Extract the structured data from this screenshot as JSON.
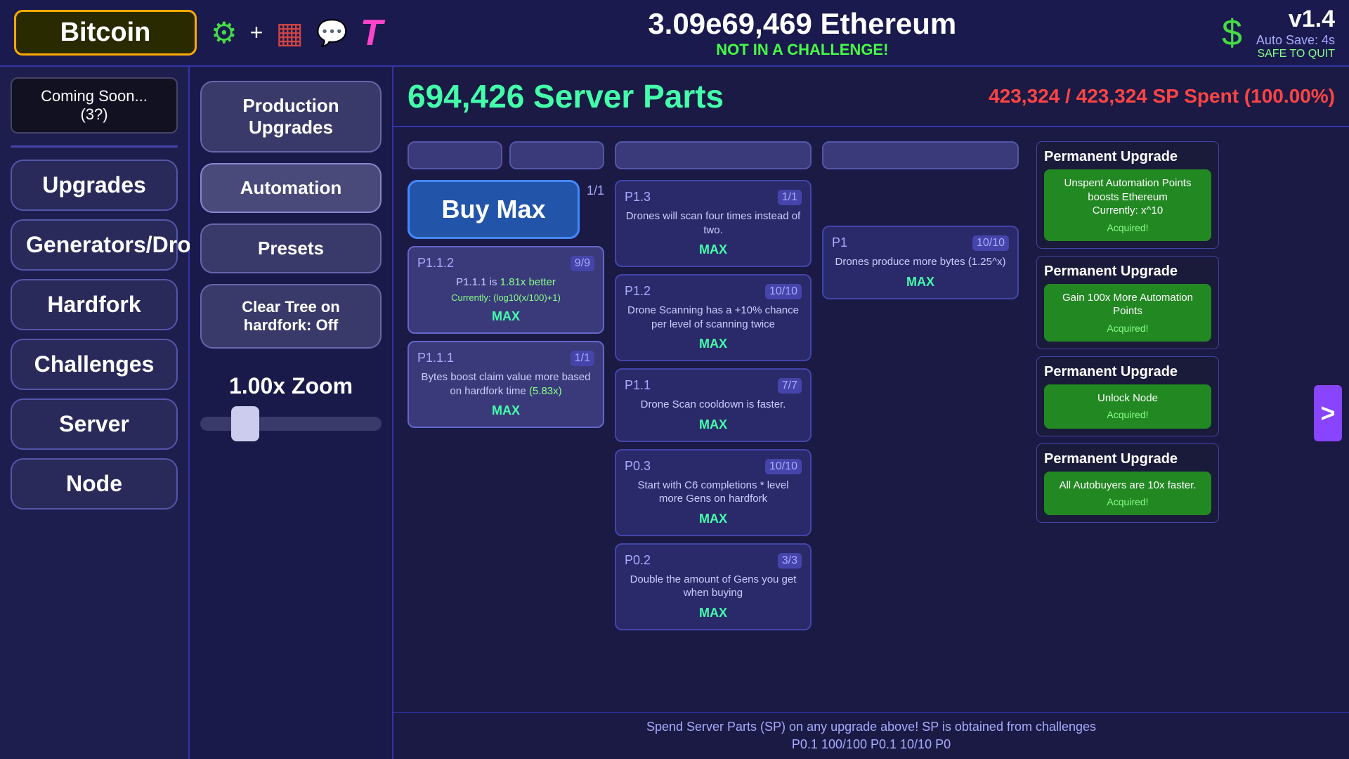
{
  "topbar": {
    "bitcoin_label": "Bitcoin",
    "ethereum_amount": "3.09e69,469 Ethereum",
    "challenge_status": "NOT IN A CHALLENGE!",
    "version": "v1.4",
    "autosave": "Auto Save: 4s",
    "safe_to_quit": "SAFE TO QUIT"
  },
  "sidebar": {
    "coming_soon": "Coming Soon... (3?)",
    "nav_items": [
      "Upgrades",
      "Generators/Drones",
      "Hardfork",
      "Challenges",
      "Server",
      "Node"
    ]
  },
  "panel": {
    "production_upgrades": "Production Upgrades",
    "automation": "Automation",
    "presets": "Presets",
    "clear_tree": "Clear Tree on hardfork: Off",
    "zoom_label": "1.00x Zoom"
  },
  "main": {
    "server_parts_title": "694,426 Server Parts",
    "sp_spent": "423,324 / 423,324 SP Spent (100.00%)",
    "buy_max": "Buy Max",
    "footer": "Spend Server Parts (SP) on any upgrade above! SP is obtained from challenges",
    "footer2": "P0.1   100/100    P0.1   10/10    P0"
  },
  "upgrades": {
    "left_col": [
      {
        "id": "buy_max",
        "label": "Buy Max",
        "badge": "1/1",
        "is_buy_max": true
      },
      {
        "id": "p1_1_2",
        "label": "P1.1.2",
        "badge": "9/9",
        "body": "P1.1.1 is 1.81x better",
        "sub": "Currently: (log10(x/100)+1)",
        "max": "MAX"
      },
      {
        "id": "p1_1_1",
        "label": "P1.1.1",
        "badge": "1/1",
        "body": "Bytes boost claim value more based on hardfork time (5.83x)",
        "max": "MAX"
      }
    ],
    "center_col": [
      {
        "id": "p1_3",
        "label": "P1.3",
        "badge": "1/1",
        "body": "Drones will scan four times instead of two.",
        "max": "MAX"
      },
      {
        "id": "p1_2",
        "label": "P1.2",
        "badge": "10/10",
        "body": "Drone Scanning has a +10% chance per level of scanning twice",
        "max": "MAX"
      },
      {
        "id": "p1_1",
        "label": "P1.1",
        "badge": "7/7",
        "body": "Drone Scan cooldown is faster.",
        "max": "MAX"
      },
      {
        "id": "p0_3",
        "label": "P0.3",
        "badge": "10/10",
        "body": "Start with C6 completions * level more Gens on hardfork",
        "max": "MAX"
      },
      {
        "id": "p0_2",
        "label": "P0.2",
        "badge": "3/3",
        "body": "Double the amount of Gens you get when buying",
        "max": "MAX"
      }
    ],
    "right_col": [
      {
        "id": "p1",
        "label": "P1",
        "badge": "10/10",
        "body": "Drones produce more bytes (1.25^x)",
        "max": "MAX"
      }
    ],
    "permanent": [
      {
        "title": "Permanent Upgrade",
        "body": "Unspent Automation Points boosts Ethereum\nCurrently: x^10",
        "acquired": "Acquired!"
      },
      {
        "title": "Permanent Upgrade",
        "body": "Gain 100x More Automation Points",
        "acquired": "Acquired!"
      },
      {
        "title": "Permanent Upgrade",
        "body": "Unlock Node",
        "acquired": "Acquired!"
      },
      {
        "title": "Permanent Upgrade",
        "body": "All Autobuyers are 10x faster.",
        "acquired": "Acquired!"
      }
    ]
  }
}
